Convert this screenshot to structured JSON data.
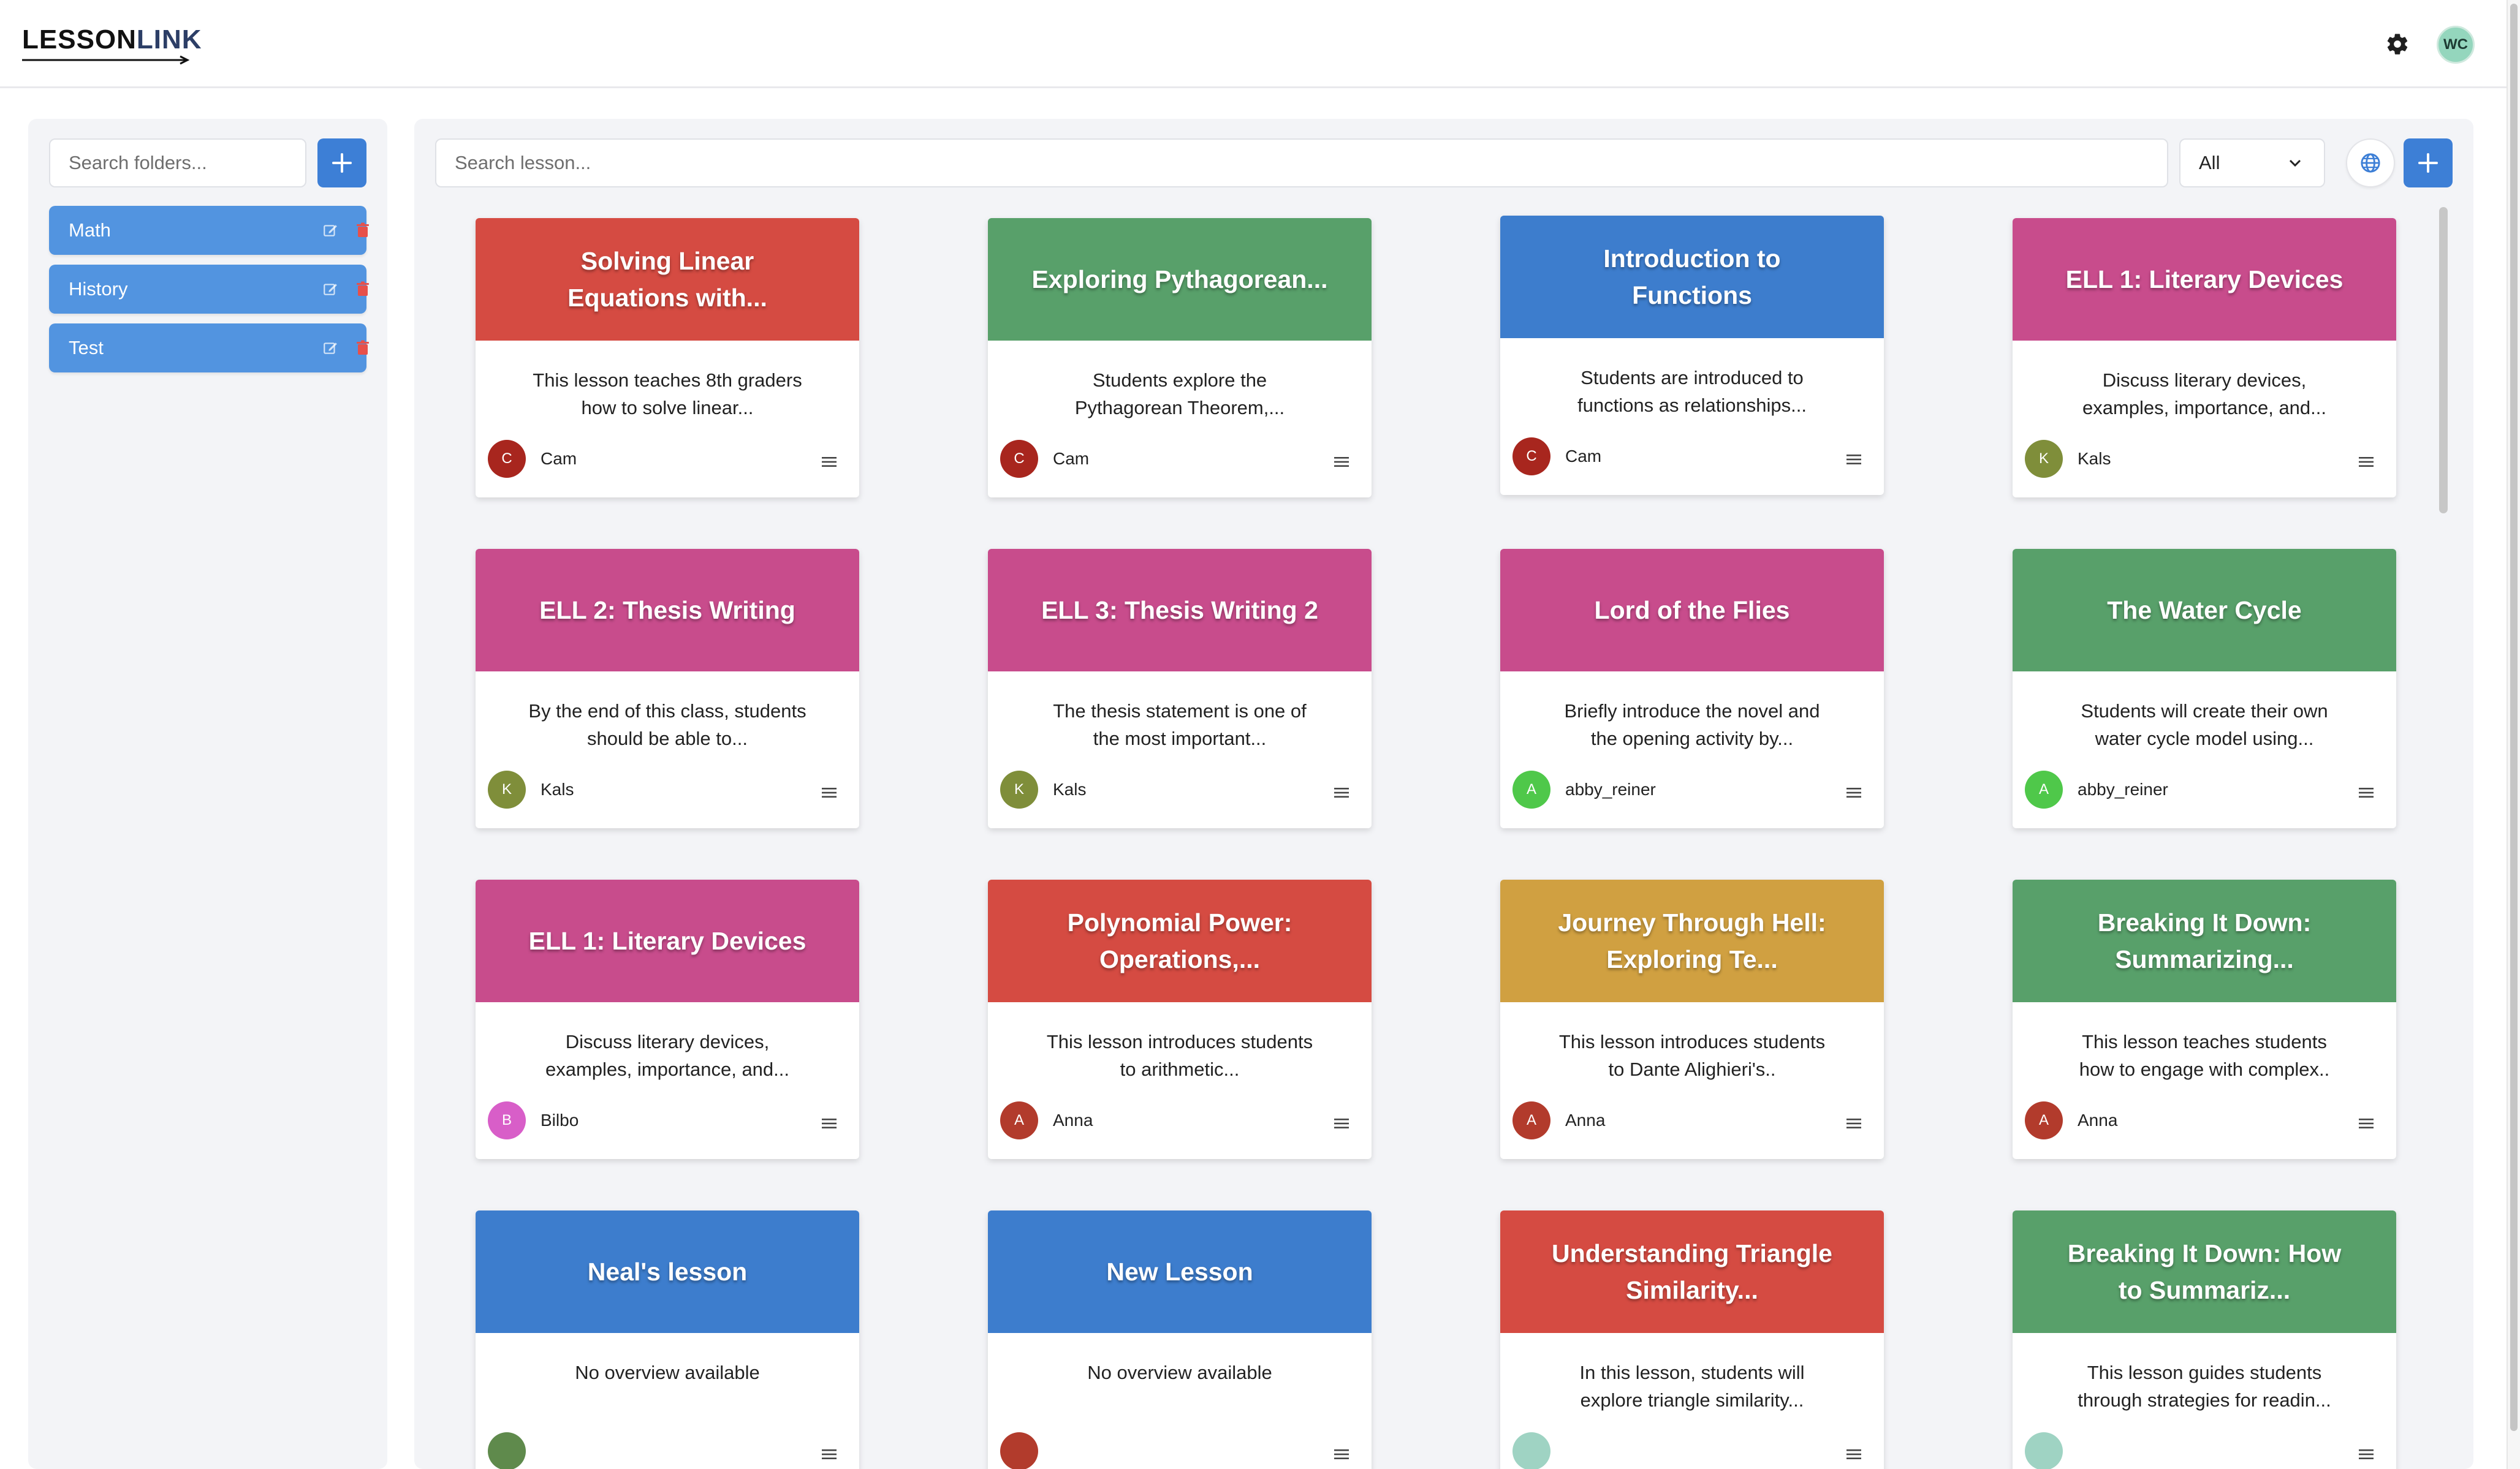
{
  "app": {
    "logo_part1": "LESSON",
    "logo_part2": "LINK",
    "user_initials": "WC"
  },
  "colors": {
    "accent": "#3d7fd6",
    "folder_item": "#5294e0",
    "red": "#d54b42",
    "green": "#58a06a",
    "blue": "#3d7dcd",
    "magenta": "#c84c8c",
    "gold": "#d0a041"
  },
  "icons": {
    "settings": "gear-icon",
    "add": "plus-icon",
    "edit": "edit-icon",
    "delete": "trash-icon",
    "menu": "hamburger-icon",
    "globe": "globe-icon",
    "dropdown": "chevron-down-icon"
  },
  "folders": {
    "search_placeholder": "Search folders...",
    "items": [
      {
        "label": "Math"
      },
      {
        "label": "History"
      },
      {
        "label": "Test"
      }
    ]
  },
  "lessons": {
    "search_placeholder": "Search lesson...",
    "filter_value": "All",
    "cards": [
      {
        "title": "Solving Linear Equations with...",
        "desc": "This lesson teaches 8th graders how to solve linear...",
        "author": "Cam",
        "initial": "C",
        "color": "#d54b42",
        "avatar_color": "#a8261e"
      },
      {
        "title": "Exploring Pythagorean...",
        "desc": "Students explore the Pythagorean Theorem,...",
        "author": "Cam",
        "initial": "C",
        "color": "#58a06a",
        "avatar_color": "#a8261e"
      },
      {
        "title": "Introduction to Functions",
        "desc": "Students are introduced to functions as relationships...",
        "author": "Cam",
        "initial": "C",
        "color": "#3d7dcd",
        "avatar_color": "#a8261e"
      },
      {
        "title": "ELL 1: Literary Devices",
        "desc": "Discuss literary devices, examples, importance, and...",
        "author": "Kals",
        "initial": "K",
        "color": "#c84c8c",
        "avatar_color": "#7f8e3a"
      },
      {
        "title": "ELL 2: Thesis Writing",
        "desc": "By the end of this class, students should be able to...",
        "author": "Kals",
        "initial": "K",
        "color": "#c84c8c",
        "avatar_color": "#7f8e3a"
      },
      {
        "title": "ELL 3: Thesis Writing 2",
        "desc": "The thesis statement is one of the most important...",
        "author": "Kals",
        "initial": "K",
        "color": "#c84c8c",
        "avatar_color": "#7f8e3a"
      },
      {
        "title": "Lord of the Flies",
        "desc": "Briefly introduce the novel and the opening activity by...",
        "author": "abby_reiner",
        "initial": "A",
        "color": "#c84c8c",
        "avatar_color": "#4fc84a"
      },
      {
        "title": "The Water Cycle",
        "desc": "Students will create their own water cycle model using...",
        "author": "abby_reiner",
        "initial": "A",
        "color": "#58a06a",
        "avatar_color": "#4fc84a"
      },
      {
        "title": "ELL 1: Literary Devices",
        "desc": "Discuss literary devices, examples, importance, and...",
        "author": "Bilbo",
        "initial": "B",
        "color": "#c84c8c",
        "avatar_color": "#d85ec8"
      },
      {
        "title": "Polynomial Power: Operations,...",
        "desc": "This lesson introduces students to arithmetic...",
        "author": "Anna",
        "initial": "A",
        "color": "#d54b42",
        "avatar_color": "#b23b2c"
      },
      {
        "title": "Journey Through Hell: Exploring Te...",
        "desc": "This lesson introduces students to Dante Alighieri's..",
        "author": "Anna",
        "initial": "A",
        "color": "#d0a041",
        "avatar_color": "#b23b2c"
      },
      {
        "title": "Breaking It Down: Summarizing...",
        "desc": "This lesson teaches students how to engage with complex..",
        "author": "Anna",
        "initial": "A",
        "color": "#58a06a",
        "avatar_color": "#b23b2c"
      },
      {
        "title": "Neal's lesson",
        "desc": "No overview available",
        "author": "",
        "initial": "",
        "color": "#3d7dcd",
        "avatar_color": "#5f8a4c"
      },
      {
        "title": "New Lesson",
        "desc": "No overview available",
        "author": "",
        "initial": "",
        "color": "#3d7dcd",
        "avatar_color": "#b23b2c"
      },
      {
        "title": "Understanding Triangle Similarity...",
        "desc": "In this lesson, students will explore triangle similarity...",
        "author": "",
        "initial": "",
        "color": "#d54b42",
        "avatar_color": "#9fd3c3"
      },
      {
        "title": "Breaking It Down: How to Summariz...",
        "desc": "This lesson guides students through strategies for readin...",
        "author": "",
        "initial": "",
        "color": "#58a06a",
        "avatar_color": "#9fd3c3"
      }
    ]
  }
}
